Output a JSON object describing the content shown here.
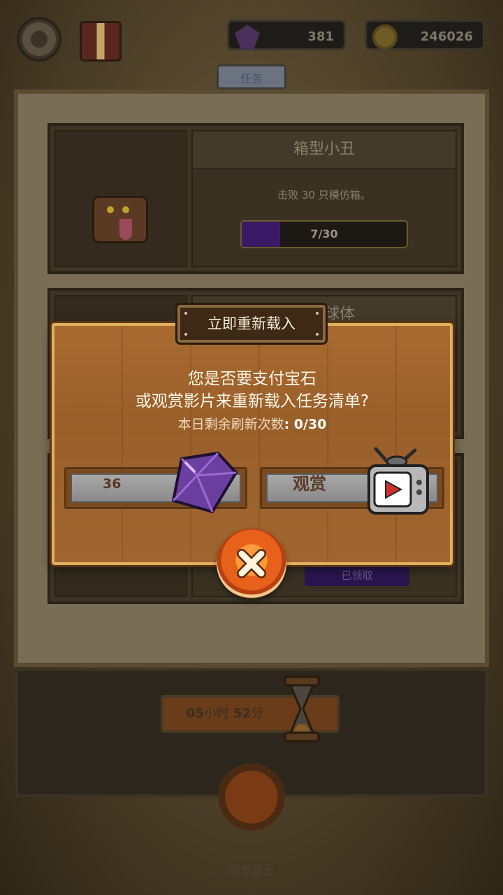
{
  "hud": {
    "gems": "381",
    "coins": "246026"
  },
  "panel": {
    "tab_label": "任务"
  },
  "quests": [
    {
      "title": "箱型小丑",
      "description": "击败 30 只模仿箱。",
      "progress_text": "7/30",
      "progress_fraction": 0.233
    },
    {
      "title": "暗影球体"
    },
    {
      "claimed_label": "已领取"
    }
  ],
  "timer": {
    "hours": "05",
    "hours_unit": "小时",
    "minutes": "52",
    "minutes_unit": "分"
  },
  "footer": {
    "text": "邮差骑士"
  },
  "modal": {
    "title": "立即重新载入",
    "question_line1": "您是否要支付宝石",
    "question_line2": "或观赏影片来重新载入任务清单?",
    "remaining_label": "本日剩余刷新次数",
    "remaining_value": ": 0/30",
    "gem_cost": "36",
    "watch_label": "观赏"
  },
  "colors": {
    "accent_orange": "#e8611a",
    "modal_wood": "#a0652e",
    "gem_purple": "#6b3fa0"
  },
  "icons": [
    "gear-icon",
    "gift-icon",
    "gem-icon",
    "coin-icon",
    "mimic-chest-icon",
    "hourglass-icon",
    "tv-icon",
    "close-icon"
  ]
}
